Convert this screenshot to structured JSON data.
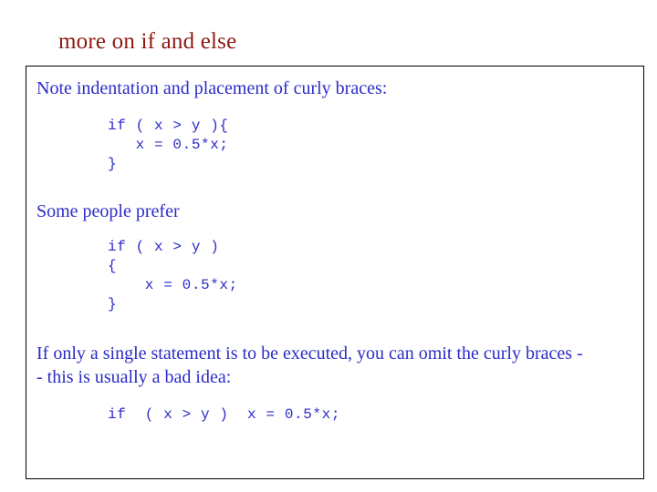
{
  "slide": {
    "title": "more on if and else",
    "paragraph1": "Note indentation and placement of curly braces:",
    "code1": "if ( x > y ){\n   x = 0.5*x;\n}",
    "paragraph2": "Some people prefer",
    "code2": "if ( x > y )\n{\n    x = 0.5*x;\n}",
    "paragraph3": "If only a single statement is to be executed, you can omit the curly braces -- this is usually a bad idea:",
    "code3": "if  ( x > y )  x = 0.5*x;",
    "colors": {
      "title": "#8c1a11",
      "text": "#2c2cc8",
      "border": "#000000",
      "background": "#ffffff"
    }
  }
}
